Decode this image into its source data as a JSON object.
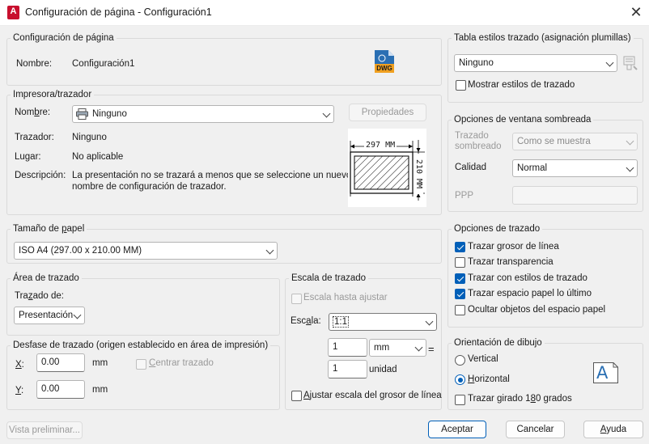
{
  "window": {
    "title": "Configuración de página - Configuración1",
    "app_icon": "A",
    "close_glyph": "✕"
  },
  "page_setup": {
    "group_title": "Configuración de página",
    "name_label": "Nombre:",
    "name_value": "Configuración1",
    "dwg_icon_text": "DWG"
  },
  "plotter": {
    "group_title": "Impresora/trazador",
    "name_label": "Nombre:",
    "name_value": "Ninguno",
    "properties_button": "Propiedades",
    "plotter_label": "Trazador:",
    "plotter_value": "Ninguno",
    "location_label": "Lugar:",
    "location_value": "No aplicable",
    "description_label": "Descripción:",
    "description_line1": "La presentación no se trazará a menos que se seleccione un nuevo",
    "description_line2": "nombre de configuración de trazador.",
    "preview_width": "297 MM",
    "preview_height": "210 MM"
  },
  "paper_size": {
    "group_title": "Tamaño de papel",
    "value": "ISO A4 (297.00 x 210.00 MM)"
  },
  "plot_area": {
    "group_title": "Área de trazado",
    "what_label": "Trazado de:",
    "what_value": "Presentación"
  },
  "plot_offset": {
    "group_title": "Desfase de trazado (origen establecido en área de impresión)",
    "x_label": "X:",
    "x_value": "0.00",
    "x_unit": "mm",
    "y_label": "Y:",
    "y_value": "0.00",
    "y_unit": "mm",
    "center_label": "Centrar trazado",
    "center_checked": false
  },
  "plot_scale": {
    "group_title": "Escala de trazado",
    "fit_label": "Escala hasta ajustar",
    "fit_checked": false,
    "scale_label": "Escala:",
    "scale_value": "1:1",
    "value1": "1",
    "unit_value": "mm",
    "equals": "=",
    "value2": "1",
    "unit2": "unidad",
    "lineweights_label": "Ajustar escala del grosor de línea",
    "lineweights_checked": false
  },
  "plot_style_table": {
    "group_title": "Tabla estilos trazado (asignación plumillas)",
    "value": "Ninguno",
    "display_label": "Mostrar estilos de trazado",
    "display_checked": false
  },
  "shaded_viewport": {
    "group_title": "Opciones de ventana sombreada",
    "shade_label_line1": "Trazado",
    "shade_label_line2": "sombreado",
    "shade_value": "Como se muestra",
    "quality_label": "Calidad",
    "quality_value": "Normal",
    "dpi_label": "PPP",
    "dpi_value": ""
  },
  "plot_options": {
    "group_title": "Opciones de trazado",
    "items": [
      {
        "label": "Trazar grosor de línea",
        "checked": true
      },
      {
        "label": "Trazar transparencia",
        "checked": false
      },
      {
        "label": "Trazar con estilos de trazado",
        "checked": true
      },
      {
        "label": "Trazar espacio papel lo último",
        "checked": true
      },
      {
        "label": "Ocultar objetos del espacio papel",
        "checked": false
      }
    ]
  },
  "orientation": {
    "group_title": "Orientación de dibujo",
    "portrait_label": "Vertical",
    "portrait_selected": false,
    "landscape_label": "Horizontal",
    "landscape_selected": true,
    "upside_down_label": "Trazar girado 180 grados",
    "upside_down_checked": false,
    "icon_letter": "A"
  },
  "footer": {
    "preview": "Vista preliminar...",
    "ok": "Aceptar",
    "cancel": "Cancelar",
    "help": "Ayuda"
  },
  "colors": {
    "accent": "#005fb8",
    "app_red": "#c8102e",
    "dwg_blue": "#2a6fb3",
    "dwg_orange": "#f0a020"
  }
}
